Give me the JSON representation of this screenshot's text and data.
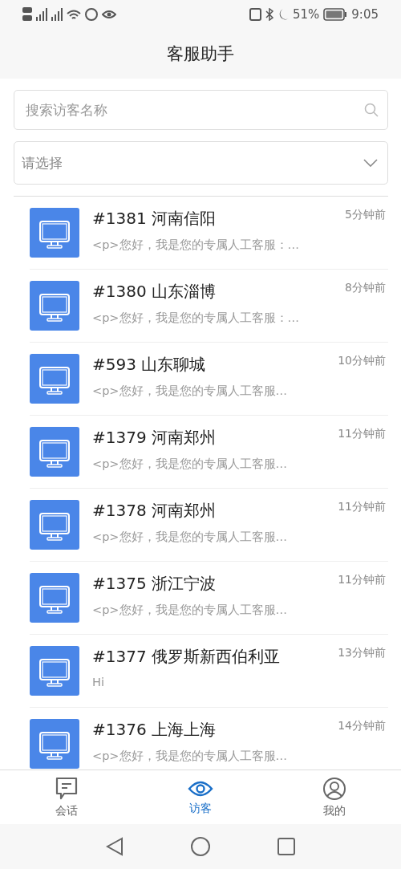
{
  "status_bar": {
    "battery": "51%",
    "time": "9:05"
  },
  "title": "客服助手",
  "search": {
    "placeholder": "搜索访客名称"
  },
  "select": {
    "placeholder": "请选择"
  },
  "visitors": [
    {
      "name": "#1381 河南信阳",
      "time": "5分钟前",
      "preview": "<p>您好，我是您的专属人工客服：…"
    },
    {
      "name": "#1380 山东淄博",
      "time": "8分钟前",
      "preview": "<p>您好，我是您的专属人工客服：…"
    },
    {
      "name": "#593 山东聊城",
      "time": "10分钟前",
      "preview": "<p>您好，我是您的专属人工客服…"
    },
    {
      "name": "#1379 河南郑州",
      "time": "11分钟前",
      "preview": "<p>您好，我是您的专属人工客服…"
    },
    {
      "name": "#1378 河南郑州",
      "time": "11分钟前",
      "preview": "<p>您好，我是您的专属人工客服…"
    },
    {
      "name": "#1375 浙江宁波",
      "time": "11分钟前",
      "preview": "<p>您好，我是您的专属人工客服…"
    },
    {
      "name": "#1377 俄罗斯新西伯利亚",
      "time": "13分钟前",
      "preview": "Hi"
    },
    {
      "name": "#1376 上海上海",
      "time": "14分钟前",
      "preview": "<p>您好，我是您的专属人工客服…"
    }
  ],
  "tabs": [
    {
      "label": "会话",
      "kind": "chat",
      "selected": false
    },
    {
      "label": "访客",
      "kind": "eye",
      "selected": true
    },
    {
      "label": "我的",
      "kind": "user",
      "selected": false
    }
  ]
}
